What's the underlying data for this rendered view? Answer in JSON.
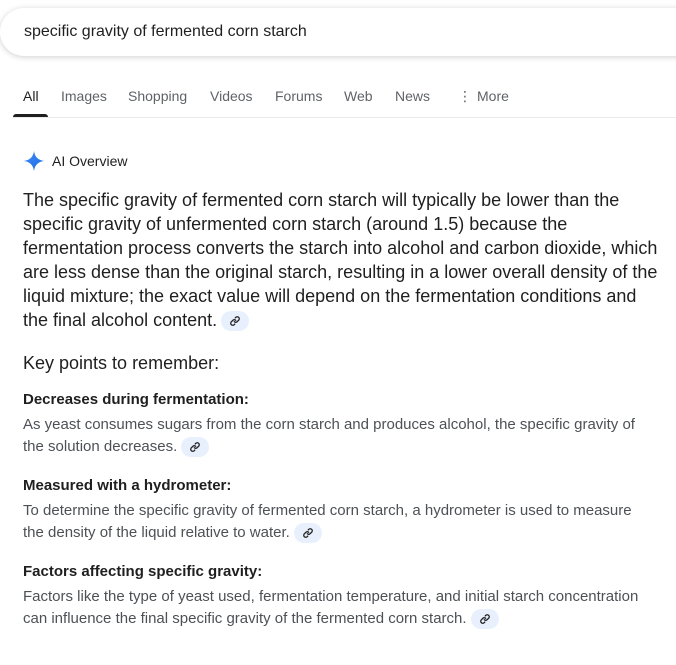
{
  "search": {
    "query": "specific gravity of fermented corn starch"
  },
  "tabs": [
    {
      "label": "All"
    },
    {
      "label": "Images"
    },
    {
      "label": "Shopping"
    },
    {
      "label": "Videos"
    },
    {
      "label": "Forums"
    },
    {
      "label": "Web"
    },
    {
      "label": "News"
    },
    {
      "label": "More"
    }
  ],
  "ai_overview": {
    "title": "AI Overview",
    "summary": "The specific gravity of fermented corn starch will typically be lower than the specific gravity of unfermented corn starch (around 1.5) because the fermentation process converts the starch into alcohol and carbon dioxide, which are less dense than the original starch, resulting in a lower overall density of the liquid mixture; the exact value will depend on the fermentation conditions and the final alcohol content.",
    "key_points_heading": "Key points to remember:",
    "points": [
      {
        "title": "Decreases during fermentation:",
        "body": "As yeast consumes sugars from the corn starch and produces alcohol, the specific gravity of the solution decreases."
      },
      {
        "title": "Measured with a hydrometer:",
        "body": "To determine the specific gravity of fermented corn starch, a hydrometer is used to measure the density of the liquid relative to water."
      },
      {
        "title": "Factors affecting specific gravity:",
        "body": "Factors like the type of yeast used, fermentation temperature, and initial starch concentration can influence the final specific gravity of the fermented corn starch."
      }
    ]
  },
  "colors": {
    "link_chip_bg": "#e8f0fe",
    "link_icon": "#1f1f1f",
    "sparkle_gradient": [
      "#4285f4",
      "#1a73e8"
    ]
  },
  "icons": {
    "ai_overview": "sparkle-icon",
    "citation": "link-icon",
    "more": "vertical-dots-icon"
  }
}
